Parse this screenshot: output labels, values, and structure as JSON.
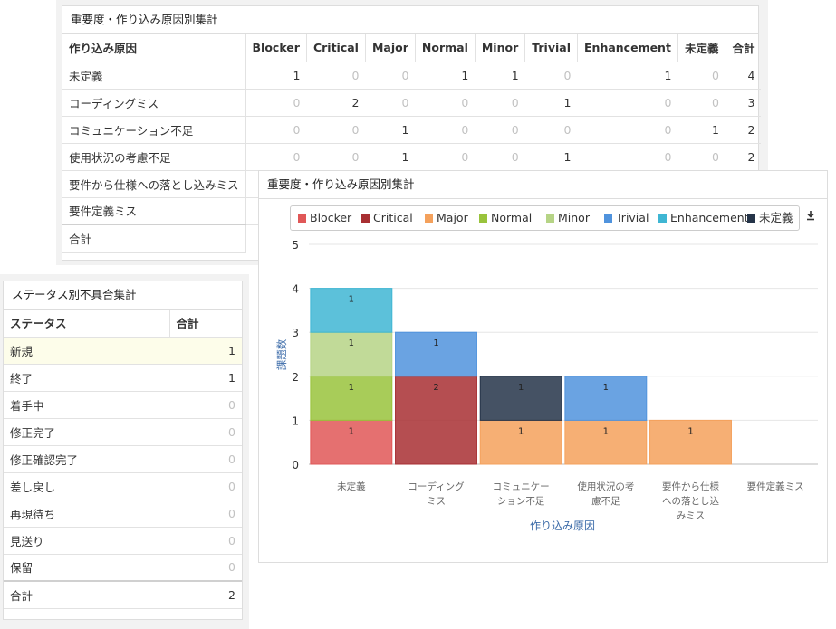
{
  "table1": {
    "title": "重要度・作り込み原因別集計",
    "headers": [
      "作り込み原因",
      "Blocker",
      "Critical",
      "Major",
      "Normal",
      "Minor",
      "Trivial",
      "Enhancement",
      "未定義",
      "合計"
    ],
    "rows": [
      {
        "label": "未定義",
        "values": [
          1,
          0,
          0,
          1,
          1,
          0,
          1,
          0,
          4
        ]
      },
      {
        "label": "コーディングミス",
        "values": [
          0,
          2,
          0,
          0,
          0,
          1,
          0,
          0,
          3
        ]
      },
      {
        "label": "コミュニケーション不足",
        "values": [
          0,
          0,
          1,
          0,
          0,
          0,
          0,
          1,
          2
        ]
      },
      {
        "label": "使用状況の考慮不足",
        "values": [
          0,
          0,
          1,
          0,
          0,
          1,
          0,
          0,
          2
        ]
      },
      {
        "label": "要件から仕様への落とし込みミス",
        "values": []
      },
      {
        "label": "要件定義ミス",
        "values": []
      }
    ],
    "total_label": "合計"
  },
  "table2": {
    "title": "ステータス別不具合集計",
    "headers": [
      "ステータス",
      "合計"
    ],
    "rows": [
      {
        "label": "新規",
        "value": 1
      },
      {
        "label": "終了",
        "value": 1
      },
      {
        "label": "着手中",
        "value": 0
      },
      {
        "label": "修正完了",
        "value": 0
      },
      {
        "label": "修正確認完了",
        "value": 0
      },
      {
        "label": "差し戻し",
        "value": 0
      },
      {
        "label": "再現待ち",
        "value": 0
      },
      {
        "label": "見送り",
        "value": 0
      },
      {
        "label": "保留",
        "value": 0
      }
    ],
    "total_label": "合計",
    "total_value": 2
  },
  "chart_panel": {
    "title": "重要度・作り込み原因別集計",
    "download_icon": "download-icon"
  },
  "chart_data": {
    "type": "bar",
    "stacked": true,
    "xlabel": "作り込み原因",
    "ylabel": "課題数",
    "ylim": [
      0,
      5
    ],
    "yticks": [
      0,
      1,
      2,
      3,
      4,
      5
    ],
    "categories": [
      "未定義",
      "コーディングミス",
      "コミュニケーション不足",
      "使用状況の考慮不足",
      "要件から仕様への落とし込みミス",
      "要件定義ミス"
    ],
    "category_lines": [
      [
        "未定義"
      ],
      [
        "コーディング",
        "ミス"
      ],
      [
        "コミュニケー",
        "ション不足"
      ],
      [
        "使用状況の考",
        "慮不足"
      ],
      [
        "要件から仕様",
        "への落とし込",
        "みミス"
      ],
      [
        "要件定義ミス"
      ]
    ],
    "legend_position": "top",
    "series": [
      {
        "name": "Blocker",
        "color": "#e05757",
        "values": [
          1,
          0,
          0,
          0,
          0,
          0
        ]
      },
      {
        "name": "Critical",
        "color": "#a82f32",
        "values": [
          0,
          2,
          0,
          0,
          0,
          0
        ]
      },
      {
        "name": "Major",
        "color": "#f4a15c",
        "values": [
          0,
          0,
          1,
          1,
          1,
          0
        ]
      },
      {
        "name": "Normal",
        "color": "#99c33c",
        "values": [
          1,
          0,
          0,
          0,
          0,
          0
        ]
      },
      {
        "name": "Minor",
        "color": "#b6d486",
        "values": [
          1,
          0,
          0,
          0,
          0,
          0
        ]
      },
      {
        "name": "Trivial",
        "color": "#5093dd",
        "values": [
          0,
          1,
          0,
          1,
          0,
          0
        ]
      },
      {
        "name": "Enhancement",
        "color": "#3fb6d3",
        "values": [
          1,
          0,
          0,
          0,
          0,
          0
        ]
      },
      {
        "name": "未定義",
        "color": "#253449",
        "values": [
          0,
          0,
          1,
          0,
          0,
          0
        ]
      }
    ]
  }
}
